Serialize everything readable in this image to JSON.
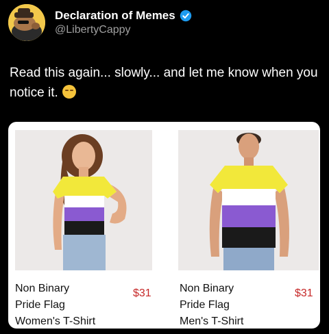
{
  "account": {
    "display_name": "Declaration of Memes",
    "handle": "@LibertyCappy",
    "verified_icon": "verified-badge-icon",
    "avatar_icon": "capybara-avatar"
  },
  "tweet": {
    "text": "Read this again... slowly... and let me know when you notice it.",
    "emoji": "smirking-face-emoji"
  },
  "products": [
    {
      "title_lines": [
        "Non Binary",
        "Pride Flag",
        "Women's T-Shirt"
      ],
      "price": "$31"
    },
    {
      "title_lines": [
        "Non Binary",
        "Pride Flag",
        "Men's T-Shirt"
      ],
      "price": "$31"
    }
  ],
  "colors": {
    "background": "#000000",
    "verified": "#1d9bf0",
    "price": "#c62828",
    "flag_yellow": "#f2e83a",
    "flag_white": "#ffffff",
    "flag_purple": "#8a5ad1",
    "flag_black": "#1a1a1a"
  }
}
